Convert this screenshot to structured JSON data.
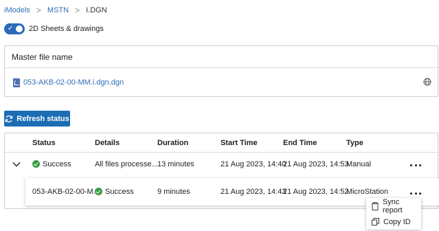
{
  "breadcrumb": {
    "items": [
      {
        "label": "iModels"
      },
      {
        "label": "MSTN"
      },
      {
        "label": "I.DGN"
      }
    ],
    "separator": ">"
  },
  "toggle": {
    "label": "2D Sheets & drawings",
    "checked": true,
    "check_glyph": "✓"
  },
  "master_file": {
    "header": "Master file name",
    "file_name": "053-AKB-02-00-MM.i.dgn.dgn",
    "file_icon": "imodel-file-icon",
    "trailing_icon": "globe-icon"
  },
  "refresh_button": {
    "label": "Refresh status",
    "icon": "refresh-icon"
  },
  "table": {
    "columns": [
      "Status",
      "Details",
      "Duration",
      "Start Time",
      "End Time",
      "Type"
    ],
    "row": {
      "expand_icon": "chevron-down-icon",
      "status": "Success",
      "details": "All files processe...",
      "duration": "13 minutes",
      "start_time": "21 Aug 2023, 14:40",
      "end_time": "21 Aug 2023, 14:53",
      "type": "Manual"
    },
    "subrow": {
      "file": "053-AKB-02-00-M...",
      "status": "Success",
      "duration": "9 minutes",
      "start_time": "21 Aug 2023, 14:43",
      "end_time": "21 Aug 2023, 14:52",
      "type": "MicroStation"
    }
  },
  "context_menu": {
    "items": [
      {
        "label": "Sync report",
        "icon": "clipboard-icon"
      },
      {
        "label": "Copy ID",
        "icon": "copy-icon"
      }
    ]
  },
  "colors": {
    "accent": "#1d6db5",
    "link": "#2f6fb5",
    "success": "#3a9b43"
  }
}
